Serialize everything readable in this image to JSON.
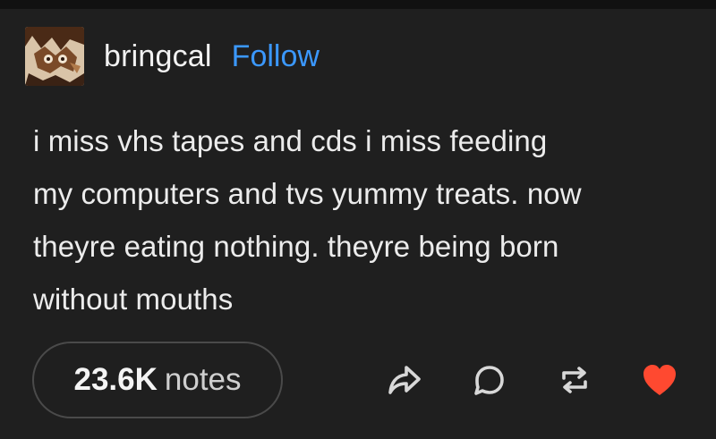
{
  "post": {
    "username": "bringcal",
    "follow_label": "Follow",
    "body_lines": [
      "i miss vhs tapes and cds i miss feeding",
      "my computers and tvs yummy treats. now",
      "theyre eating nothing. theyre being born",
      "without mouths"
    ],
    "notes_count": "23.6K",
    "notes_label": "notes"
  },
  "icons": {
    "share": "share-icon",
    "reply": "reply-icon",
    "reblog": "reblog-icon",
    "like": "heart-icon"
  },
  "colors": {
    "background": "#1f1f1f",
    "text": "#ececec",
    "follow": "#3b98ff",
    "like": "#ff4930"
  }
}
